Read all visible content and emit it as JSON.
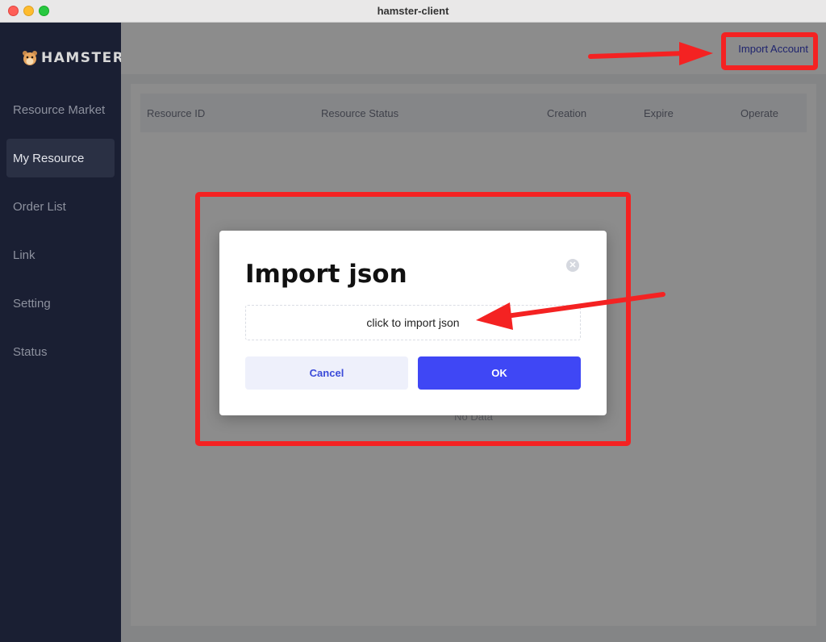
{
  "window": {
    "title": "hamster-client"
  },
  "sidebar": {
    "logo_text": "HAMSTER",
    "items": [
      {
        "label": "Resource Market",
        "active": false
      },
      {
        "label": "My Resource",
        "active": true
      },
      {
        "label": "Order List",
        "active": false
      },
      {
        "label": "Link",
        "active": false
      },
      {
        "label": "Setting",
        "active": false
      },
      {
        "label": "Status",
        "active": false
      }
    ]
  },
  "header": {
    "import_account_label": "Import Account"
  },
  "table": {
    "columns": [
      "Resource ID",
      "Resource Status",
      "Creation",
      "Expire",
      "Operate"
    ],
    "empty_text": "No Data"
  },
  "modal": {
    "title": "Import json",
    "upload_label": "click to import json",
    "cancel_label": "Cancel",
    "ok_label": "OK"
  },
  "colors": {
    "sidebar_bg": "#1a1f33",
    "accent": "#3f47f5",
    "annotation": "#f42222",
    "link": "#3a43c8"
  }
}
